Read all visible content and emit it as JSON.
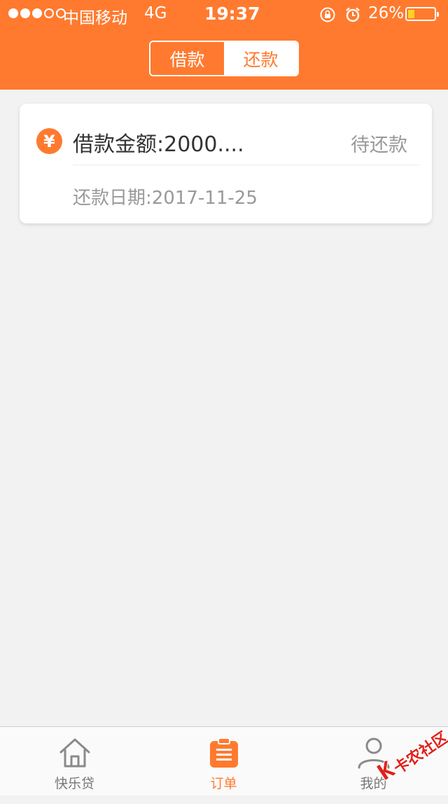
{
  "status_bar": {
    "carrier": "中国移动",
    "network": "4G",
    "time": "19:37",
    "battery_percent": "26%",
    "battery_level": 0.26,
    "signal_bars_filled": 3,
    "signal_bars_total": 5
  },
  "header": {
    "tabs": [
      {
        "label": "借款",
        "active": true
      },
      {
        "label": "还款",
        "active": false
      }
    ]
  },
  "loan_card": {
    "amount": "借款金额:2000....",
    "status": "待还款",
    "repay_date": "还款日期:2017-11-25",
    "icon": "yen-icon"
  },
  "tabbar": {
    "items": [
      {
        "label": "快乐贷",
        "icon": "home-icon",
        "active": false
      },
      {
        "label": "订单",
        "icon": "clipboard-icon",
        "active": true
      },
      {
        "label": "我的",
        "icon": "user-icon",
        "active": false
      }
    ]
  },
  "watermark": {
    "text": "卡农社区"
  },
  "colors": {
    "accent": "#ff7a2f",
    "background": "#f2f2f2",
    "text_primary": "#333333",
    "text_secondary": "#999999"
  }
}
